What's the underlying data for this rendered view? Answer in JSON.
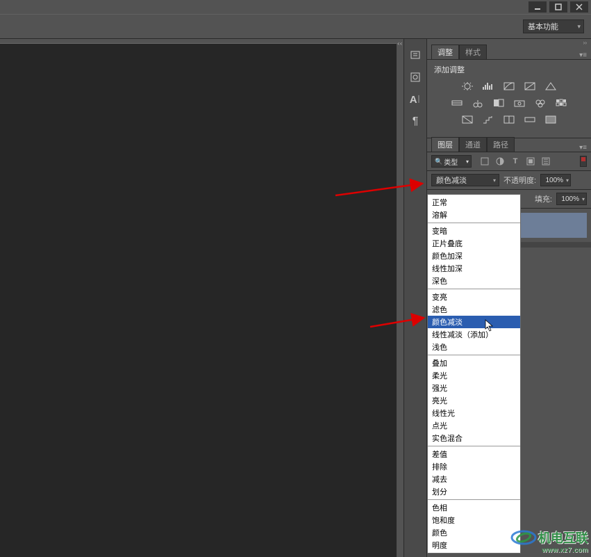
{
  "window": {
    "workspace_label": "基本功能"
  },
  "adjustments_panel": {
    "tab_adjustments": "调整",
    "tab_styles": "样式",
    "add_label": "添加调整"
  },
  "layers_panel": {
    "tab_layers": "图层",
    "tab_channels": "通道",
    "tab_paths": "路径",
    "filter_label": "类型",
    "blend_value": "颜色减淡",
    "opacity_label": "不透明度:",
    "opacity_value": "100%",
    "fill_label": "填充:",
    "fill_value": "100%"
  },
  "blend_modes": {
    "group1": [
      "正常",
      "溶解"
    ],
    "group2": [
      "变暗",
      "正片叠底",
      "颜色加深",
      "线性加深",
      "深色"
    ],
    "group3": [
      "变亮",
      "滤色",
      "颜色减淡",
      "线性减淡（添加）",
      "浅色"
    ],
    "group4": [
      "叠加",
      "柔光",
      "强光",
      "亮光",
      "线性光",
      "点光",
      "实色混合"
    ],
    "group5": [
      "差值",
      "排除",
      "减去",
      "划分"
    ],
    "group6": [
      "色相",
      "饱和度",
      "颜色",
      "明度"
    ],
    "selected": "颜色减淡"
  },
  "watermark": {
    "line1": "机电互联",
    "line2": "www.xz7.com"
  }
}
